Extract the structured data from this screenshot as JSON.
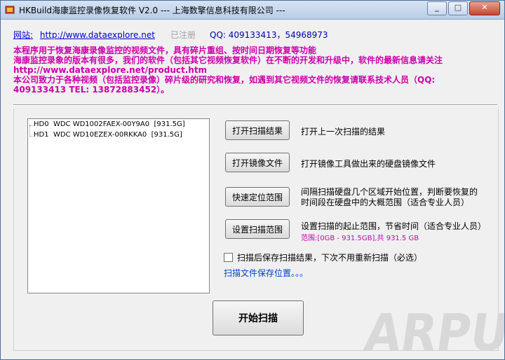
{
  "window": {
    "title": "HKBuild海康监控录像恢复软件 V2.0 --- 上海数擎信息科技有限公司 ---",
    "minimize": "_",
    "maximize": "□",
    "close": "✕"
  },
  "header": {
    "site_label": "网站:",
    "site_url": "http://www.dataexplore.net",
    "registered": "已注册",
    "qq": "QQ: 409133413，54968973"
  },
  "info_lines": [
    "本程序用于恢复海康录像监控的视频文件，具有碎片重组、按时间日期恢复等功能",
    "海康监控录象的版本有很多，我们的软件（包括其它视频恢复软件）在不断的开发和升级中，软件的最新信息请关注",
    "http://www.dataexplore.net/product.htm",
    "本公司致力于各种视频（包括监控录像）碎片级的研究和恢复，如遇到其它视频文件的恢复请联系技术人员（QQ:",
    "409133413 TEL: 13872883452）。"
  ],
  "disks": [
    {
      "id": "HD0",
      "model": "WDC WD1002FAEX-00Y9A0",
      "size": "[931.5G]"
    },
    {
      "id": "HD1",
      "model": "WDC WD10EZEX-00RKKA0",
      "size": "[931.5G]"
    }
  ],
  "actions": {
    "open_scan_result": {
      "label": "打开扫描结果",
      "desc": "打开上一次扫描的结果"
    },
    "open_image_file": {
      "label": "打开镜像文件",
      "desc": "打开镜像工具做出来的硬盘镜像文件"
    },
    "quick_locate": {
      "label": "快速定位范围",
      "desc_line1": "间隔扫描硬盘几个区域开始位置，判断要恢复的",
      "desc_line2": "时间段在硬盘中的大概范围（适合专业人员）"
    },
    "set_scan_range": {
      "label": "设置扫描范围",
      "desc": "设置扫描的起止范围，节省时间（适合专业人员）",
      "range": "范围:[0GB - 931.5GB],共 931.5 GB"
    }
  },
  "save_after_scan": "扫描后保存扫描结果，下次不用重新扫描（必选）",
  "save_location": "扫描文件保存位置。。。",
  "start_scan": "开始扫描",
  "watermark": "ARPUN",
  "colors": {
    "accent_magenta": "#cc00aa",
    "link_blue": "#0000cc"
  }
}
